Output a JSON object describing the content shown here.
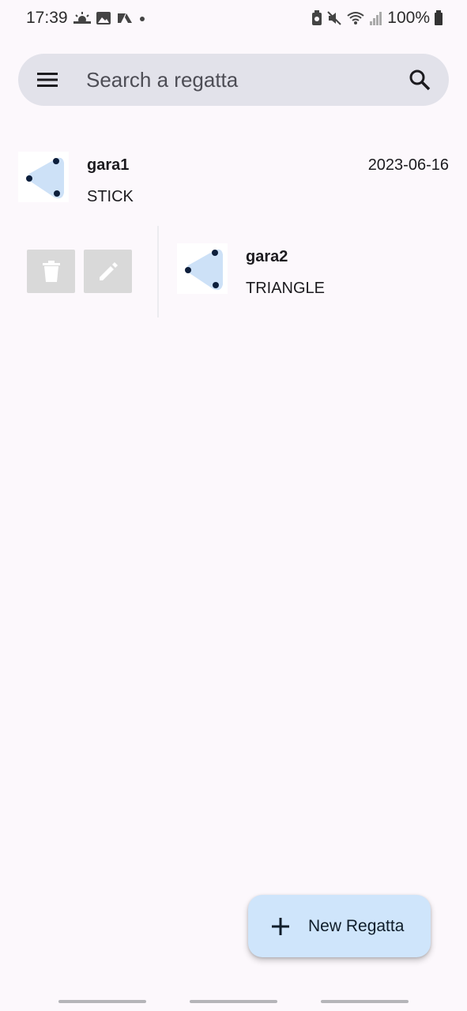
{
  "status_bar": {
    "time": "17:39",
    "battery": "100%",
    "left_icons": [
      "weather-icon",
      "image-icon",
      "app-icon",
      "dot-icon"
    ],
    "right_icons": [
      "lock-battery-icon",
      "mute-icon",
      "wifi-icon",
      "signal-icon",
      "battery-icon"
    ]
  },
  "search": {
    "placeholder": "Search a regatta"
  },
  "regattas": [
    {
      "name": "gara1",
      "type": "STICK",
      "date": "2023-06-16"
    },
    {
      "name": "gara2",
      "type": "TRIANGLE",
      "date": ""
    }
  ],
  "actions": {
    "delete_icon": "trash-icon",
    "edit_icon": "pencil-icon"
  },
  "fab": {
    "label": "New Regatta",
    "icon": "plus-icon"
  },
  "colors": {
    "background": "#fcf8fc",
    "search_bg": "#e2e2ea",
    "fab_bg": "#cfe5fb",
    "thumb_shape": "#cde1f7",
    "thumb_dot": "#0d1f3c",
    "action_bg": "#d9d9d9"
  }
}
